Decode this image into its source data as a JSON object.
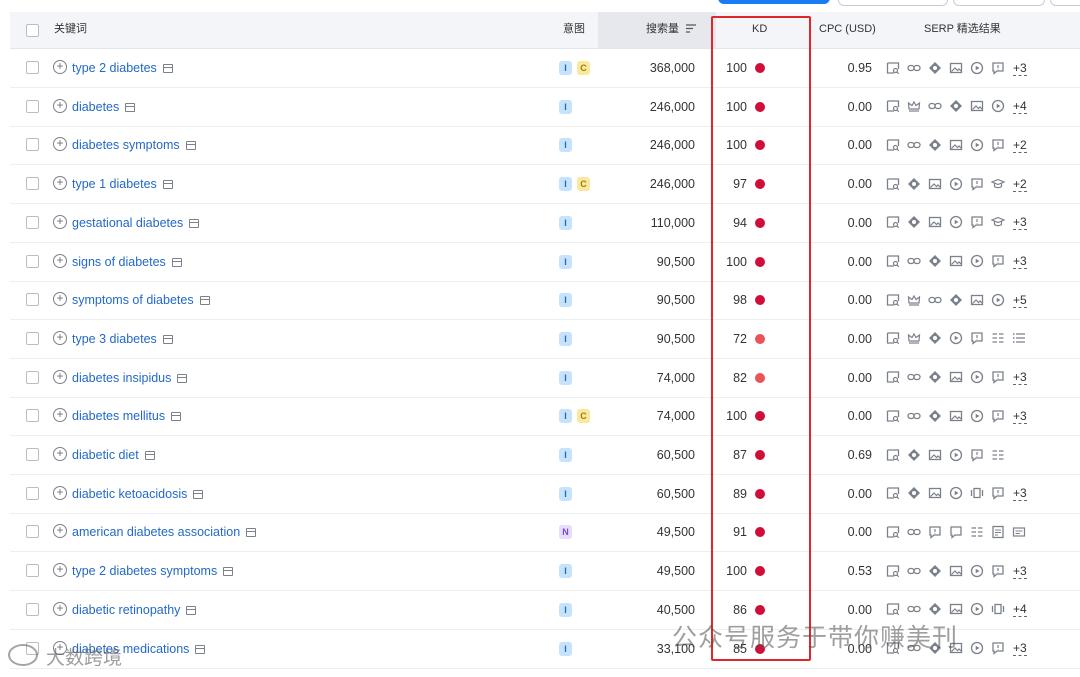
{
  "header": {
    "keyword": "关键词",
    "intent": "意图",
    "volume": "搜索量",
    "kd": "KD",
    "cpc": "CPC (USD)",
    "serp": "SERP 精选结果"
  },
  "colors": {
    "kd_very_hard": "#cf0e39",
    "kd_hard": "#ec5259",
    "highlight_box": "#e0262a",
    "link": "#2369c8"
  },
  "rows": [
    {
      "keyword": "type 2 diabetes",
      "intents": [
        "I",
        "C"
      ],
      "volume": "368,000",
      "kd": "100",
      "kd_level": "very_hard",
      "cpc": "0.95",
      "serp": [
        "serp-preview-icon",
        "link-icon",
        "diamond-icon",
        "image-icon",
        "video-icon",
        "faq-icon"
      ],
      "more": "+3"
    },
    {
      "keyword": "diabetes",
      "intents": [
        "I"
      ],
      "volume": "246,000",
      "kd": "100",
      "kd_level": "very_hard",
      "cpc": "0.00",
      "serp": [
        "serp-preview-icon",
        "crown-icon",
        "link-icon",
        "diamond-icon",
        "image-icon",
        "video-icon"
      ],
      "more": "+4"
    },
    {
      "keyword": "diabetes symptoms",
      "intents": [
        "I"
      ],
      "volume": "246,000",
      "kd": "100",
      "kd_level": "very_hard",
      "cpc": "0.00",
      "serp": [
        "serp-preview-icon",
        "link-icon",
        "diamond-icon",
        "image-icon",
        "video-icon",
        "faq-icon"
      ],
      "more": "+2"
    },
    {
      "keyword": "type 1 diabetes",
      "intents": [
        "I",
        "C"
      ],
      "volume": "246,000",
      "kd": "97",
      "kd_level": "very_hard",
      "cpc": "0.00",
      "serp": [
        "serp-preview-icon",
        "diamond-icon",
        "image-icon",
        "video-icon",
        "faq-icon",
        "graduation-icon"
      ],
      "more": "+2"
    },
    {
      "keyword": "gestational diabetes",
      "intents": [
        "I"
      ],
      "volume": "110,000",
      "kd": "94",
      "kd_level": "very_hard",
      "cpc": "0.00",
      "serp": [
        "serp-preview-icon",
        "diamond-icon",
        "image-icon",
        "video-icon",
        "faq-icon",
        "graduation-icon"
      ],
      "more": "+3"
    },
    {
      "keyword": "signs of diabetes",
      "intents": [
        "I"
      ],
      "volume": "90,500",
      "kd": "100",
      "kd_level": "very_hard",
      "cpc": "0.00",
      "serp": [
        "serp-preview-icon",
        "link-icon",
        "diamond-icon",
        "image-icon",
        "video-icon",
        "faq-icon"
      ],
      "more": "+3"
    },
    {
      "keyword": "symptoms of diabetes",
      "intents": [
        "I"
      ],
      "volume": "90,500",
      "kd": "98",
      "kd_level": "very_hard",
      "cpc": "0.00",
      "serp": [
        "serp-preview-icon",
        "crown-icon",
        "link-icon",
        "diamond-icon",
        "image-icon",
        "video-icon"
      ],
      "more": "+5"
    },
    {
      "keyword": "type 3 diabetes",
      "intents": [
        "I"
      ],
      "volume": "90,500",
      "kd": "72",
      "kd_level": "hard",
      "cpc": "0.00",
      "serp": [
        "serp-preview-icon",
        "crown-icon",
        "diamond-icon",
        "video-icon",
        "faq-icon",
        "table-icon",
        "list-icon"
      ],
      "more": ""
    },
    {
      "keyword": "diabetes insipidus",
      "intents": [
        "I"
      ],
      "volume": "74,000",
      "kd": "82",
      "kd_level": "hard",
      "cpc": "0.00",
      "serp": [
        "serp-preview-icon",
        "link-icon",
        "diamond-icon",
        "image-icon",
        "video-icon",
        "faq-icon"
      ],
      "more": "+3"
    },
    {
      "keyword": "diabetes mellitus",
      "intents": [
        "I",
        "C"
      ],
      "volume": "74,000",
      "kd": "100",
      "kd_level": "very_hard",
      "cpc": "0.00",
      "serp": [
        "serp-preview-icon",
        "link-icon",
        "diamond-icon",
        "image-icon",
        "video-icon",
        "faq-icon"
      ],
      "more": "+3"
    },
    {
      "keyword": "diabetic diet",
      "intents": [
        "I"
      ],
      "volume": "60,500",
      "kd": "87",
      "kd_level": "very_hard",
      "cpc": "0.69",
      "serp": [
        "serp-preview-icon",
        "diamond-icon",
        "image-icon",
        "video-icon",
        "faq-icon",
        "table-icon"
      ],
      "more": ""
    },
    {
      "keyword": "diabetic ketoacidosis",
      "intents": [
        "I"
      ],
      "volume": "60,500",
      "kd": "89",
      "kd_level": "very_hard",
      "cpc": "0.00",
      "serp": [
        "serp-preview-icon",
        "diamond-icon",
        "image-icon",
        "video-icon",
        "carousel-icon",
        "faq-icon"
      ],
      "more": "+3"
    },
    {
      "keyword": "american diabetes association",
      "intents": [
        "N"
      ],
      "volume": "49,500",
      "kd": "91",
      "kd_level": "very_hard",
      "cpc": "0.00",
      "serp": [
        "serp-preview-icon",
        "link-icon",
        "faq-icon",
        "review-icon",
        "table-icon",
        "article-icon",
        "ad-icon"
      ],
      "more": ""
    },
    {
      "keyword": "type 2 diabetes symptoms",
      "intents": [
        "I"
      ],
      "volume": "49,500",
      "kd": "100",
      "kd_level": "very_hard",
      "cpc": "0.53",
      "serp": [
        "serp-preview-icon",
        "link-icon",
        "diamond-icon",
        "image-icon",
        "video-icon",
        "faq-icon"
      ],
      "more": "+3"
    },
    {
      "keyword": "diabetic retinopathy",
      "intents": [
        "I"
      ],
      "volume": "40,500",
      "kd": "86",
      "kd_level": "very_hard",
      "cpc": "0.00",
      "serp": [
        "serp-preview-icon",
        "link-icon",
        "diamond-icon",
        "image-icon",
        "video-icon",
        "carousel-icon"
      ],
      "more": "+4"
    },
    {
      "keyword": "diabetes medications",
      "intents": [
        "I"
      ],
      "volume": "33,100",
      "kd": "85",
      "kd_level": "very_hard",
      "cpc": "0.00",
      "serp": [
        "serp-preview-icon",
        "link-icon",
        "diamond-icon",
        "image-icon",
        "video-icon",
        "faq-icon"
      ],
      "more": "+3"
    }
  ],
  "watermark": {
    "right": "公众号服务于带你赚美刊",
    "left": "大数跨境"
  }
}
